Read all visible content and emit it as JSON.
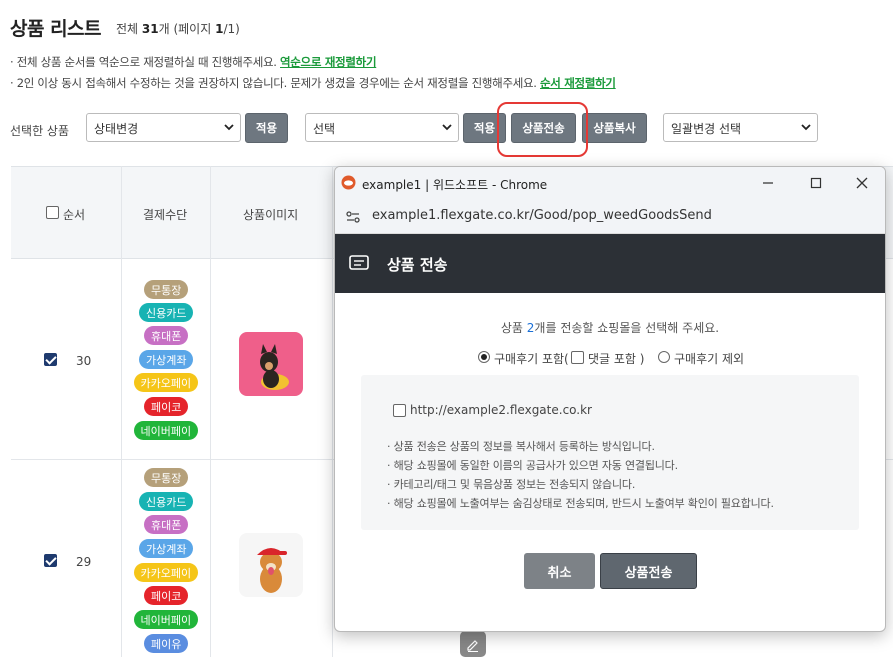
{
  "page": {
    "title": "상품 리스트",
    "count_prefix": "전체 ",
    "count_value": "31",
    "count_suffix": "개 (페이지 ",
    "page_value": "1",
    "page_suffix": "/1)"
  },
  "notices": [
    {
      "text": "· 전체 상품 순서를 역순으로 재정렬하실 때 진행해주세요. ",
      "link": "역순으로 재정렬하기"
    },
    {
      "text": "· 2인 이상 동시 접속해서 수정하는 것을 권장하지 않습니다. 문제가 생겼을 경우에는 순서 재정렬을 진행해주세요. ",
      "link": "순서 재정렬하기"
    }
  ],
  "toolbar": {
    "selected_label": "선택한 상품",
    "status_select": "상태변경",
    "apply1": "적용",
    "select2": "선택",
    "apply2": "적용",
    "send_button": "상품전송",
    "copy_button": "상품복사",
    "bulk_select": "일괄변경 선택"
  },
  "table": {
    "headers": {
      "order": "순서",
      "payment": "결제수단",
      "image": "상품이미지"
    },
    "rows": [
      {
        "num": "30",
        "badges": [
          "무통장",
          "신용카드",
          "휴대폰",
          "가상계좌",
          "카카오페이",
          "페이코",
          "네이버페이"
        ]
      },
      {
        "num": "29",
        "badges": [
          "무통장",
          "신용카드",
          "휴대폰",
          "가상계좌",
          "카카오페이",
          "페이코",
          "네이버페이",
          "페이유"
        ]
      }
    ]
  },
  "badge_colors": {
    "무통장": "#b5a07a",
    "신용카드": "#17b3b3",
    "휴대폰": "#c770c4",
    "가상계좌": "#5aa6e8",
    "카카오페이": "#f5c518",
    "페이코": "#e5242b",
    "네이버페이": "#21b53a",
    "페이유": "#5a8de0"
  },
  "popup": {
    "window_title": "example1 | 위드소프트 - Chrome",
    "url": "example1.flexgate.co.kr/Good/pop_weedGoodsSend",
    "dialog_title": "상품 전송",
    "msg_prefix": "상품 ",
    "msg_count": "2",
    "msg_suffix": "개를 전송할 쇼핑몰을 선택해 주세요.",
    "opt_review_include": "구매후기 포함(",
    "opt_comment_include": "댓글 포함 )",
    "opt_review_exclude": "구매후기 제외",
    "site": "http://example2.flexgate.co.kr",
    "info": [
      "· 상품 전송은 상품의 정보를 복사해서 등록하는 방식입니다.",
      "· 해당 쇼핑몰에 동일한 이름의 공급사가 있으면 자동 연결됩니다.",
      "· 카테고리/태그 및 묶음상품 정보는 전송되지 않습니다.",
      "· 해당 쇼핑몰에 노출여부는 숨김상태로 전송되며, 반드시 노출여부 확인이 필요합니다."
    ],
    "cancel": "취소",
    "submit": "상품전송"
  }
}
